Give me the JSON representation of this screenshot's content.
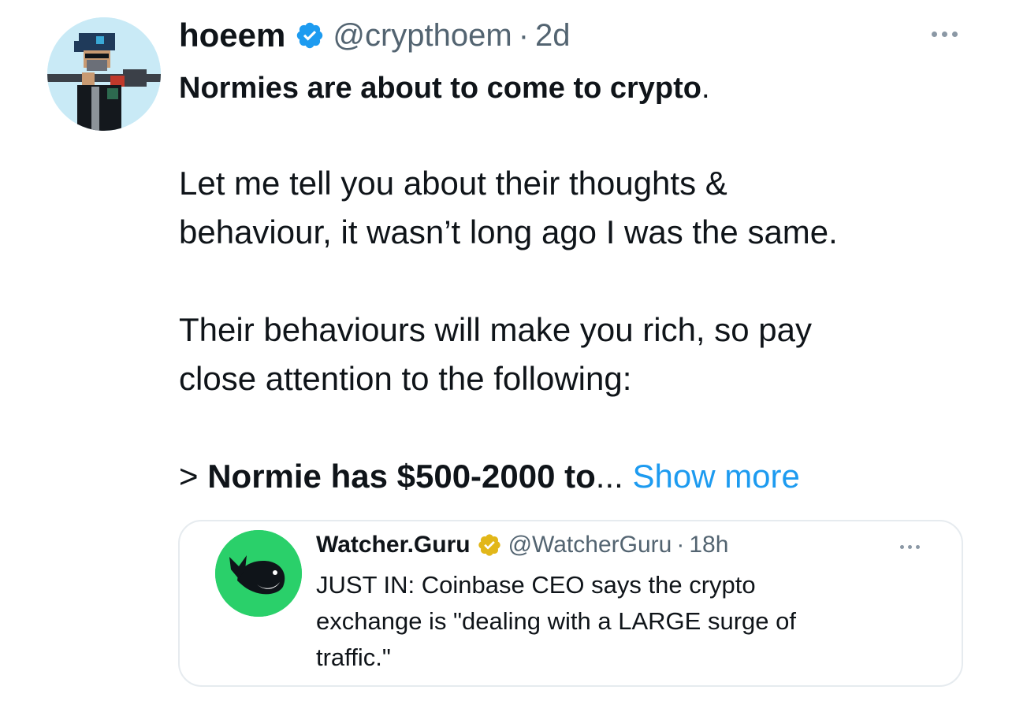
{
  "tweet": {
    "author_name": "hoeem",
    "handle": "@crypthoem",
    "separator": "·",
    "time": "2d",
    "headline_bold": "Normies are about to come to crypto",
    "headline_end": ".",
    "paragraph1_line1": "Let me tell you about their thoughts &",
    "paragraph1_line2": "behaviour, it wasn’t long ago I was the same.",
    "paragraph2_line1": "Their behaviours will make you rich, so pay",
    "paragraph2_line2": "close attention to the following:",
    "truncated_prefix": "> ",
    "truncated_bold": "Normie has $500-2000 to",
    "ellipsis": "... ",
    "show_more_label": "Show more"
  },
  "quoted_tweet": {
    "author_name": "Watcher.Guru",
    "handle": "@WatcherGuru",
    "separator": "·",
    "time": "18h",
    "text_line1": "JUST IN: Coinbase CEO says the crypto",
    "text_line2": "exchange is \"dealing with a LARGE surge of",
    "text_line3": "traffic.\""
  },
  "icons": {
    "verified": "verified-badge-icon",
    "more": "more-options-icon"
  },
  "colors": {
    "link": "#1d9bf0",
    "verified_blue": "#1d9bf0",
    "verified_gold": "#e2b719",
    "secondary_text": "#536471",
    "quote_avatar_bg": "#2ad06a"
  }
}
